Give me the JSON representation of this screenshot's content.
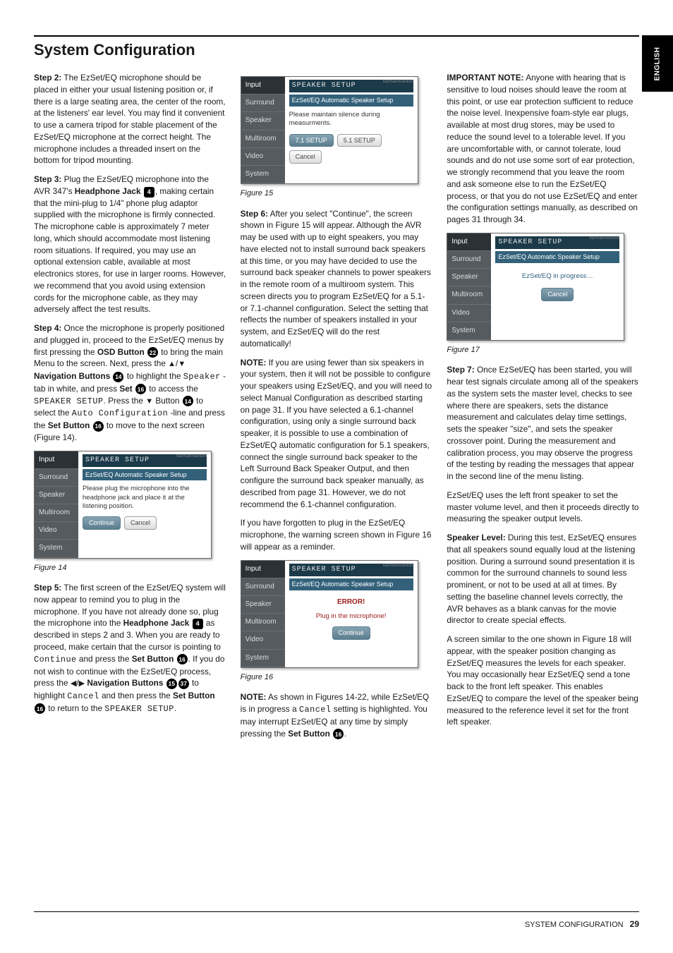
{
  "sidebar": {
    "lang": "ENGLISH"
  },
  "header": {
    "title": "System Configuration"
  },
  "footer": {
    "section": "SYSTEM CONFIGURATION",
    "page": "29"
  },
  "col1": {
    "p1a": "Step 2:",
    "p1b": " The EzSet/EQ microphone should be placed in either your usual listening position or, if there is a large seating area, the center of the room, at the listeners' ear level. You may find it convenient to use a camera tripod for stable placement of the EzSet/EQ microphone at the correct height. The microphone includes a threaded insert on the bottom for tripod mounting.",
    "p2a": "Step 3:",
    "p2b": " Plug the EzSet/EQ microphone into the AVR 347's ",
    "p2c": "Headphone Jack ",
    "p2d": ", making certain that the mini-plug to 1/4\" phone plug adaptor supplied with the microphone is firmly connected. The microphone cable is approximately 7 meter long, which should accommodate most listening room situations. If required, you may use an optional extension cable, available at most electronics stores, for use in larger rooms. However, we recommend that you avoid using extension cords for the microphone cable, as they may adversely affect the test results.",
    "p3a": "Step 4:",
    "p3b": " Once the microphone is properly positioned and plugged in, proceed to the EzSet/EQ menus by first pressing the ",
    "p3c": "OSD Button ",
    "p3d": " to bring the main Menu to the screen. Next, press the ",
    "p3e": " Navigation Buttons ",
    "p3f": " to highlight the ",
    "p3g": "Speaker",
    "p3g2": " -tab in white, and press ",
    "p3h": "Set ",
    "p3i": " to access the ",
    "p3j": "SPEAKER SETUP",
    "p3k": ". Press the ",
    "p3l": " Button ",
    "p3m": " to select the ",
    "p3n": "Auto Configuration",
    "p3o": " -line and press the ",
    "p3p": "Set Button ",
    "p3q": " to move to the next screen (Figure 14).",
    "fig14": "Figure 14",
    "p4a": "Step 5:",
    "p4b": " The first screen of the EzSet/EQ system will now appear to remind you to plug in the microphone. If you have not already done so, plug the microphone into the ",
    "p4c": "Headphone Jack ",
    "p4d": " as described in steps 2 and 3. When you are ready to proceed, make certain that the cursor is pointing to ",
    "p4e": "Continue",
    "p4f": " and press the ",
    "p4g": "Set Button ",
    "p4h": ". If you do not wish to continue with the EzSet/EQ process, press the ",
    "p4i": "Navigation Buttons ",
    "p4j": " to highlight ",
    "p4k": "Cancel",
    "p4l": " and then press the ",
    "p4m": "Set Button ",
    "p4n": " to return to the ",
    "p4o": "SPEAKER SETUP",
    "p4p": "."
  },
  "col2": {
    "fig15": "Figure 15",
    "p1a": "Step 6:",
    "p1b": " After you select \"Continue\", the screen shown in Figure 15 will appear. Although the AVR may be used with up to eight speakers, you may have elected not to install surround back speakers at this time, or you may have decided to use the surround back speaker channels to power speakers in the remote room of a multiroom system. This screen directs you to program EzSet/EQ for a 5.1- or 7.1-channel configuration. Select the setting that reflects the number of speakers installed in your system, and EzSet/EQ will do the rest automatically!",
    "p2a": "NOTE:",
    "p2b": " If you are using fewer than six speakers in your system, then it will not be possible to configure your speakers using EzSet/EQ, and you will need to select Manual Configuration as described starting on page 31. If you have selected a 6.1-channel configuration, using only a single surround back speaker, it is possible to use a combination of EzSet/EQ automatic configuration for 5.1 speakers, connect the single surround back speaker to the Left Surround Back Speaker Output, and then configure the surround back speaker manually, as described from page 31. However, we do not recommend the 6.1-channel configuration.",
    "p3": "If you have forgotten to plug in the EzSet/EQ microphone, the warning screen shown in Figure 16 will appear as a reminder.",
    "fig16": "Figure 16",
    "p4a": "NOTE:",
    "p4b": " As shown in Figures 14-22, while EzSet/EQ is in progress a ",
    "p4c": "Cancel",
    "p4d": " setting is highlighted. You may interrupt EzSet/EQ at any time by simply pressing the ",
    "p4e": "Set Button ",
    "p4f": "."
  },
  "col3": {
    "p1a": "IMPORTANT NOTE:",
    "p1b": " Anyone with hearing that is sensitive to loud noises should leave the room at this point, or use ear protection sufficient to reduce the noise level. Inexpensive foam-style ear plugs, available at most drug stores, may be used to reduce the sound level to a tolerable level. If you are uncomfortable with, or cannot tolerate, loud sounds and do not use some sort of ear protection, we strongly recommend that you leave the room and ask someone else to run the EzSet/EQ process, or that you do not use EzSet/EQ and enter the configuration settings manually, as described on pages 31 through 34.",
    "fig17": "Figure 17",
    "p2a": "Step 7:",
    "p2b": " Once EzSet/EQ has been started, you will hear test signals circulate among all of the speakers as the system sets the master level, checks to see where there are speakers, sets the distance measurement and calculates delay time settings, sets the speaker \"size\", and sets the speaker crossover point. During the measurement and calibration process, you may observe the progress of the testing by reading the messages that appear in the second line of the menu listing.",
    "p3": "EzSet/EQ uses the left front speaker to set the master volume level, and then it proceeds directly to measuring the speaker output levels.",
    "p4a": "Speaker Level:",
    "p4b": " During this test, EzSet/EQ ensures that all speakers sound equally loud at the listening position. During a surround sound presentation it is common for the surround channels to sound less prominent, or not to be used at all at times. By setting the baseline channel levels correctly, the AVR behaves as a blank canvas for the movie director to create special effects.",
    "p5": "A screen similar to the one shown in Figure 18 will appear, with the speaker position changing as EzSet/EQ measures the levels for each speaker. You may occasionally hear EzSet/EQ send a tone back to the front left speaker. This enables EzSet/EQ to compare the level of the speaker being measured to the reference level it set for the front left speaker."
  },
  "menu": {
    "tabs": [
      "Input",
      "Surround",
      "Speaker",
      "Multiroom",
      "Video",
      "System"
    ],
    "title": "SPEAKER SETUP",
    "sub": "EzSet/EQ Automatic Speaker Setup",
    "logo": "harman/kardon",
    "fig14_msg": "Please plug the microphone into the headphone jack and place it at the listening position.",
    "fig14_btn1": "Continue",
    "fig14_btn2": "Cancel",
    "fig15_msg": "Please maintain silence during measurments.",
    "fig15_btn1": "7.1 SETUP",
    "fig15_btn2": "5.1 SETUP",
    "fig15_btn3": "Cancel",
    "fig16_err": "ERROR!",
    "fig16_msg": "Plug in the microphone!",
    "fig16_btn": "Continue",
    "fig17_msg": "EzSet/EQ in progress…",
    "fig17_btn": "Cancel"
  }
}
